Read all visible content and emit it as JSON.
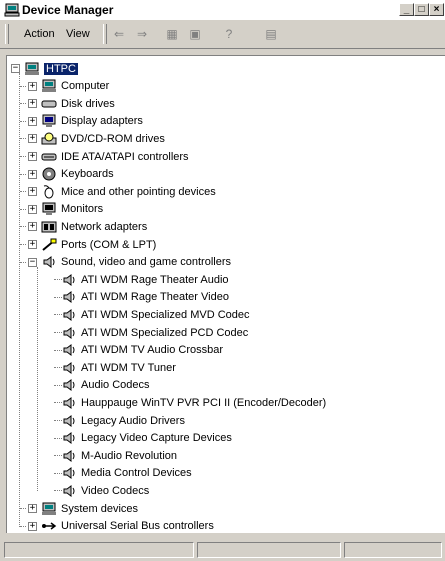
{
  "window": {
    "title": "Device Manager"
  },
  "toolbar": {
    "menus": [
      "Action",
      "View"
    ],
    "buttons": [
      "back-icon",
      "forward-icon",
      "up-icon",
      "properties-icon",
      "help-icon",
      "scan-hardware-icon"
    ]
  },
  "tree": {
    "root": "HTPC",
    "categories": [
      {
        "label": "Computer",
        "icon": "computer-icon",
        "expanded": false
      },
      {
        "label": "Disk drives",
        "icon": "disk-drive-icon",
        "expanded": false
      },
      {
        "label": "Display adapters",
        "icon": "display-adapter-icon",
        "expanded": false
      },
      {
        "label": "DVD/CD-ROM drives",
        "icon": "cdrom-icon",
        "expanded": false
      },
      {
        "label": "IDE ATA/ATAPI controllers",
        "icon": "ide-controller-icon",
        "expanded": false
      },
      {
        "label": "Keyboards",
        "icon": "keyboard-icon",
        "expanded": false
      },
      {
        "label": "Mice and other pointing devices",
        "icon": "mouse-icon",
        "expanded": false
      },
      {
        "label": "Monitors",
        "icon": "monitor-icon",
        "expanded": false
      },
      {
        "label": "Network adapters",
        "icon": "network-adapter-icon",
        "expanded": false
      },
      {
        "label": "Ports (COM & LPT)",
        "icon": "port-icon",
        "expanded": false
      },
      {
        "label": "Sound, video and game controllers",
        "icon": "sound-icon",
        "expanded": true,
        "children": [
          "ATI WDM Rage Theater Audio",
          "ATI WDM Rage Theater Video",
          "ATI WDM Specialized MVD Codec",
          "ATI WDM Specialized PCD Codec",
          "ATI WDM TV Audio Crossbar",
          "ATI WDM TV Tuner",
          "Audio Codecs",
          "Hauppauge WinTV PVR PCI II (Encoder/Decoder)",
          "Legacy Audio Drivers",
          "Legacy Video Capture Devices",
          "M-Audio Revolution",
          "Media Control Devices",
          "Video Codecs"
        ]
      },
      {
        "label": "System devices",
        "icon": "system-devices-icon",
        "expanded": false
      },
      {
        "label": "Universal Serial Bus controllers",
        "icon": "usb-icon",
        "expanded": false
      }
    ]
  },
  "colors": {
    "selection": "#0a246a",
    "chrome": "#d4d0c8"
  }
}
